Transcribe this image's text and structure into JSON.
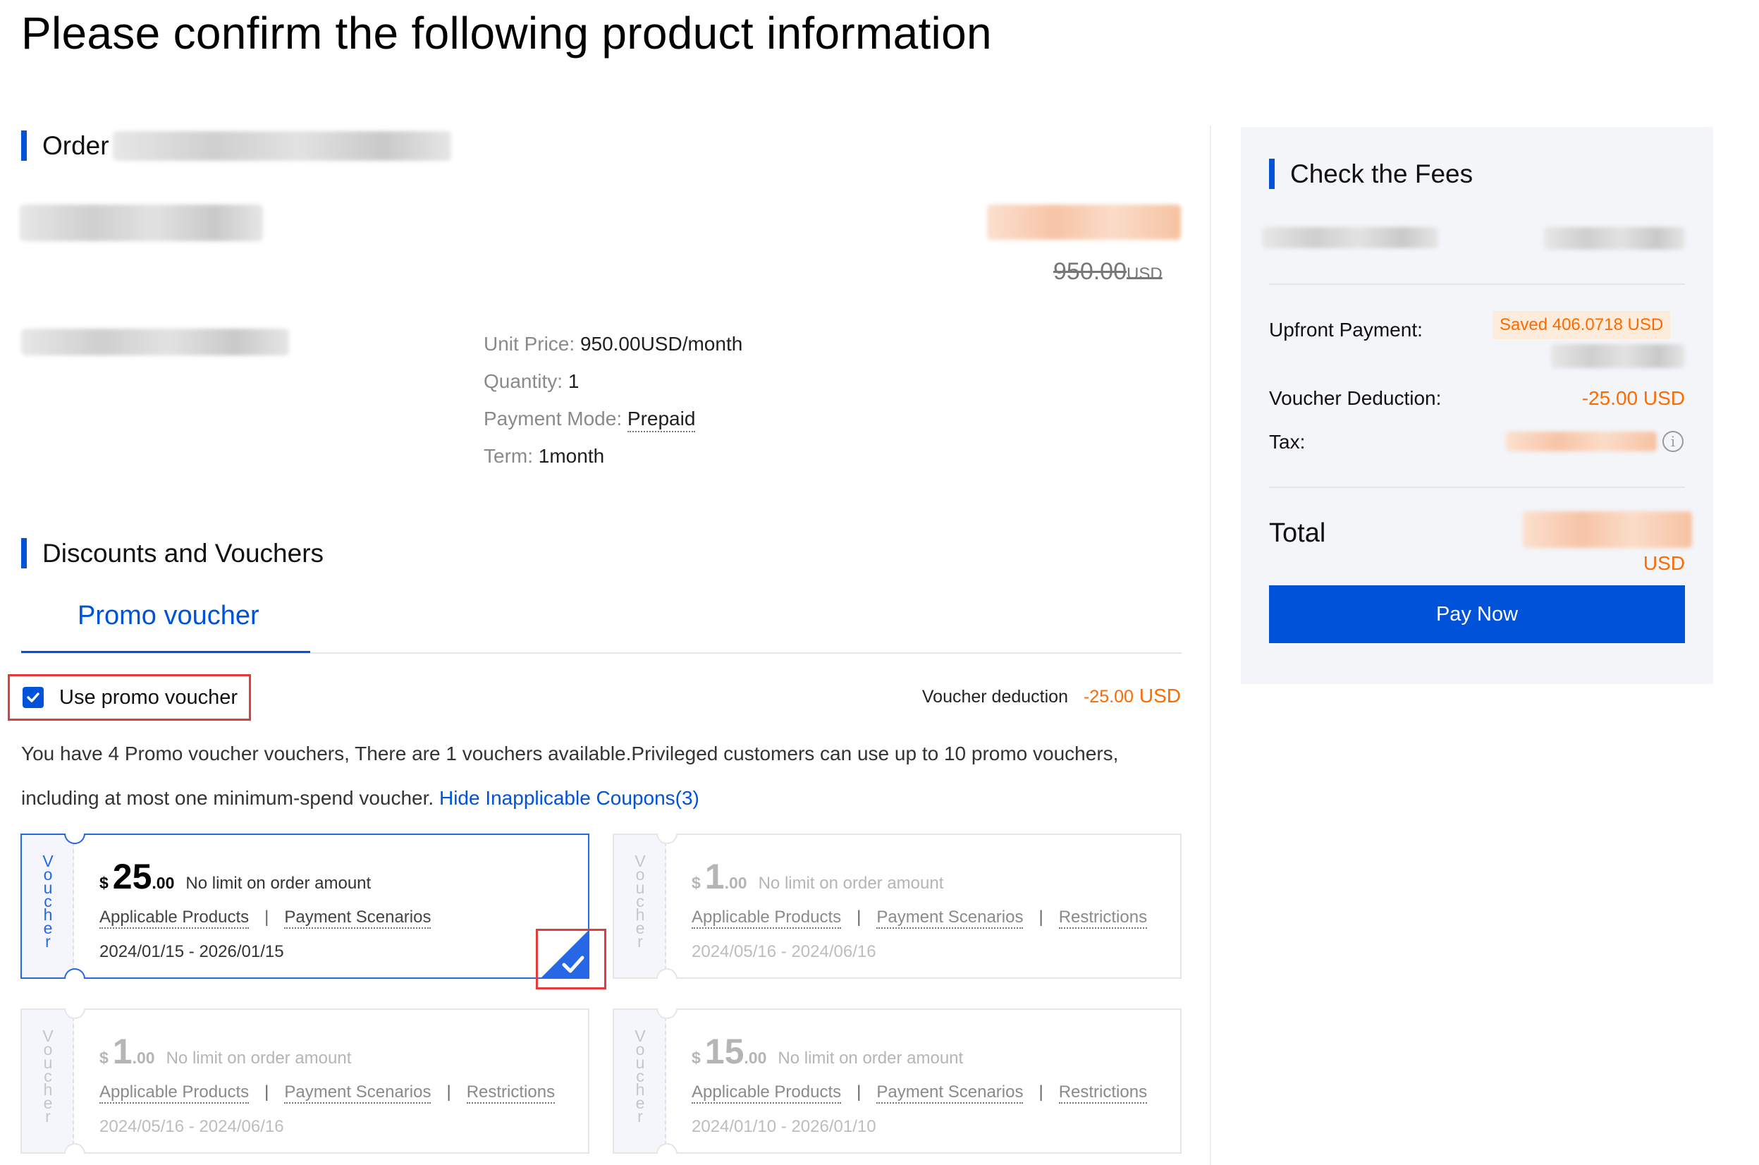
{
  "page": {
    "title": "Please confirm the following product information"
  },
  "order": {
    "heading": "Order",
    "original_price": "950.00",
    "original_price_currency": "USD",
    "specs": {
      "unit_price_label": "Unit Price:",
      "unit_price_value": "950.00USD/month",
      "quantity_label": "Quantity:",
      "quantity_value": "1",
      "payment_mode_label": "Payment Mode:",
      "payment_mode_value": "Prepaid",
      "term_label": "Term:",
      "term_value": "1month"
    }
  },
  "discounts": {
    "heading": "Discounts and Vouchers",
    "tab_label": "Promo voucher",
    "use_voucher_label": "Use promo voucher",
    "use_voucher_checked": true,
    "voucher_deduction_label": "Voucher deduction",
    "voucher_deduction_amount": "-25.00",
    "voucher_deduction_currency": "USD",
    "description_line1": "You have 4 Promo voucher vouchers, There are 1 vouchers available.Privileged customers can use up to 10 promo vouchers,",
    "description_line2": "including at most one minimum-spend voucher.",
    "hide_link": "Hide Inapplicable Coupons(3)"
  },
  "vouchers": [
    {
      "strip": "Voucher",
      "symbol": "$",
      "int": "25",
      "dec": ".00",
      "limit": "No limit on order amount",
      "link1": "Applicable Products",
      "link2": "Payment Scenarios",
      "link3": "",
      "dates": "2024/01/15 - 2026/01/15",
      "selected": true,
      "disabled": false
    },
    {
      "strip": "Voucher",
      "symbol": "$",
      "int": "1",
      "dec": ".00",
      "limit": "No limit on order amount",
      "link1": "Applicable Products",
      "link2": "Payment Scenarios",
      "link3": "Restrictions",
      "dates": "2024/05/16 - 2024/06/16",
      "selected": false,
      "disabled": true
    },
    {
      "strip": "Voucher",
      "symbol": "$",
      "int": "1",
      "dec": ".00",
      "limit": "No limit on order amount",
      "link1": "Applicable Products",
      "link2": "Payment Scenarios",
      "link3": "Restrictions",
      "dates": "2024/05/16 - 2024/06/16",
      "selected": false,
      "disabled": true
    },
    {
      "strip": "Voucher",
      "symbol": "$",
      "int": "15",
      "dec": ".00",
      "limit": "No limit on order amount",
      "link1": "Applicable Products",
      "link2": "Payment Scenarios",
      "link3": "Restrictions",
      "dates": "2024/01/10 - 2026/01/10",
      "selected": false,
      "disabled": true
    }
  ],
  "fees": {
    "heading": "Check the Fees",
    "upfront_label": "Upfront Payment:",
    "saved_badge": "Saved 406.0718 USD",
    "voucher_label": "Voucher Deduction:",
    "voucher_value": "-25.00 USD",
    "tax_label": "Tax:",
    "total_label": "Total",
    "total_currency": "USD",
    "pay_button": "Pay Now"
  },
  "colors": {
    "primary": "#0052d9",
    "accent_orange": "#ff6a00",
    "highlight_red": "#e23b3b"
  }
}
